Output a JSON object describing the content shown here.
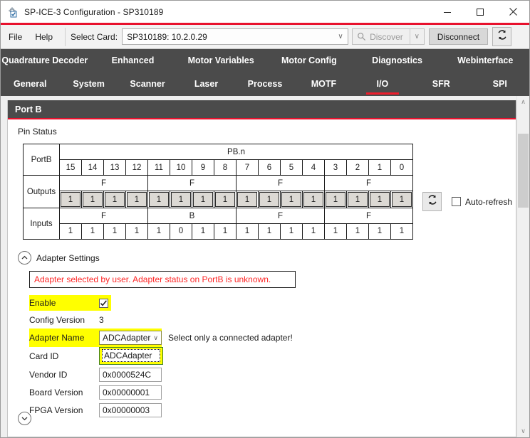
{
  "window": {
    "title": "SP-ICE-3 Configuration - SP310189",
    "icon": "app-config-icon",
    "minimize": "─",
    "maximize": "☐",
    "close": "✕",
    "accent_red": "#e8112d"
  },
  "toolbar": {
    "menus": [
      "File",
      "Help"
    ],
    "select_card_label": "Select Card:",
    "select_card_value": "SP310189: 10.2.0.29",
    "discover_label": "Discover",
    "discover_icon": "magnifier-icon",
    "disconnect_label": "Disconnect",
    "refresh_icon": "refresh-icon",
    "dropdown_arrow": "∨"
  },
  "tabs": {
    "row1": [
      {
        "label": "Quadrature Decoder",
        "active": false
      },
      {
        "label": "Enhanced",
        "active": false
      },
      {
        "label": "Motor Variables",
        "active": false
      },
      {
        "label": "Motor Config",
        "active": false
      },
      {
        "label": "Diagnostics",
        "active": false
      },
      {
        "label": "Webinterface",
        "active": false
      }
    ],
    "row2": [
      {
        "label": "General",
        "active": false
      },
      {
        "label": "System",
        "active": false
      },
      {
        "label": "Scanner",
        "active": false
      },
      {
        "label": "Laser",
        "active": false
      },
      {
        "label": "Process",
        "active": false
      },
      {
        "label": "MOTF",
        "active": false
      },
      {
        "label": "I/O",
        "active": true
      },
      {
        "label": "SFR",
        "active": false
      },
      {
        "label": "SPI",
        "active": false
      }
    ]
  },
  "panel": {
    "title": "Port B",
    "pin_status_label": "Pin Status"
  },
  "pin_table": {
    "port_label": "PortB",
    "group_header": "PB.n",
    "bit_indices": [
      "15",
      "14",
      "13",
      "12",
      "11",
      "10",
      "9",
      "8",
      "7",
      "6",
      "5",
      "4",
      "3",
      "2",
      "1",
      "0"
    ],
    "outputs_label": "Outputs",
    "outputs_nibbles": [
      "F",
      "F",
      "F",
      "F"
    ],
    "outputs_bits": [
      "1",
      "1",
      "1",
      "1",
      "1",
      "1",
      "1",
      "1",
      "1",
      "1",
      "1",
      "1",
      "1",
      "1",
      "1",
      "1"
    ],
    "inputs_label": "Inputs",
    "inputs_nibbles": [
      "F",
      "B",
      "F",
      "F"
    ],
    "inputs_bits": [
      "1",
      "1",
      "1",
      "1",
      "1",
      "0",
      "1",
      "1",
      "1",
      "1",
      "1",
      "1",
      "1",
      "1",
      "1",
      "1"
    ]
  },
  "pin_controls": {
    "refresh_icon": "refresh-icon",
    "auto_refresh_label": "Auto-refresh",
    "auto_refresh_checked": false
  },
  "adapter": {
    "section_label": "Adapter Settings",
    "collapse_icon": "chevron-up-icon",
    "warning": "Adapter selected by user. Adapter status on PortB is unknown.",
    "warning_color": "#fe2626",
    "highlight_color": "#ffff00",
    "fields": {
      "enable_label": "Enable",
      "enable_checked": true,
      "config_version_label": "Config Version",
      "config_version_value": "3",
      "adapter_name_label": "Adapter Name",
      "adapter_name_value": "ADCAdapter",
      "adapter_name_hint": "Select only a connected adapter!",
      "card_id_label": "Card ID",
      "card_id_value": "",
      "vendor_id_label": "Vendor ID",
      "vendor_id_value": "0x0000524C",
      "board_version_label": "Board Version",
      "board_version_value": "0x00000001",
      "fpga_version_label": "FPGA Version",
      "fpga_version_value": "0x00000003"
    },
    "dropdown_options": [
      "ADCAdapter"
    ]
  },
  "scrollbar": {
    "up_arrow": "∧",
    "down_arrow": "∨"
  }
}
